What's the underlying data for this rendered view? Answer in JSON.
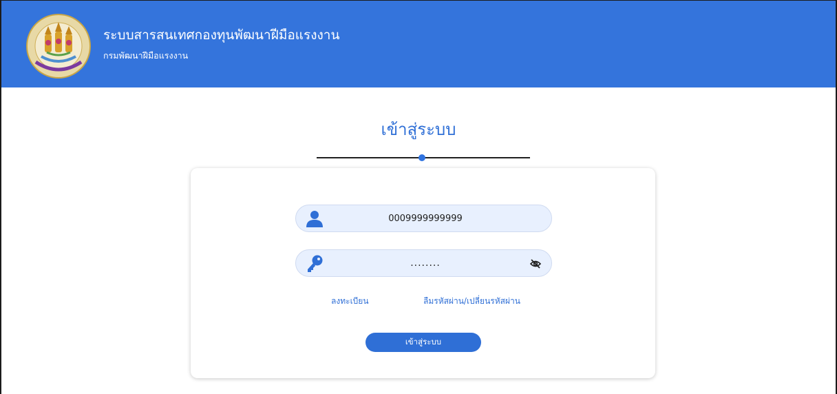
{
  "header": {
    "title": "ระบบสารสนเทศกองทุนพัฒนาฝีมือแรงงาน",
    "subtitle": "กรมพัฒนาฝีมือแรงงาน",
    "logo_icon": "department-seal-logo",
    "background_color": "#3474dc"
  },
  "login": {
    "title": "เข้าสู่ระบบ",
    "username": {
      "value": "0009999999999",
      "icon": "user-icon"
    },
    "password": {
      "value": "........",
      "icon": "key-icon",
      "toggle_icon": "eye-off-icon"
    },
    "register_link": "ลงทะเบียน",
    "forgot_link": "ลืมรหัสผ่าน/เปลี่ยนรหัสผ่าน",
    "submit_label": "เข้าสู่ระบบ",
    "accent_color": "#2f6fd6"
  }
}
